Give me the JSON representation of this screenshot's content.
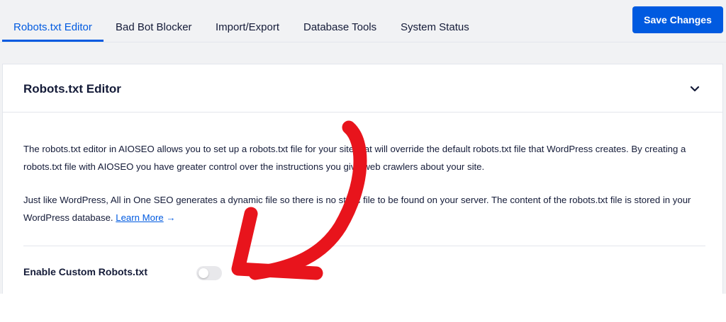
{
  "tabs": [
    {
      "label": "Robots.txt Editor",
      "active": true
    },
    {
      "label": "Bad Bot Blocker",
      "active": false
    },
    {
      "label": "Import/Export",
      "active": false
    },
    {
      "label": "Database Tools",
      "active": false
    },
    {
      "label": "System Status",
      "active": false
    }
  ],
  "header": {
    "save_label": "Save Changes"
  },
  "card": {
    "title": "Robots.txt Editor",
    "paragraph1": "The robots.txt editor in AIOSEO allows you to set up a robots.txt file for your site that will override the default robots.txt file that WordPress creates. By creating a robots.txt file with AIOSEO you have greater control over the instructions you give web crawlers about your site.",
    "paragraph2": "Just like WordPress, All in One SEO generates a dynamic file so there is no static file to be found on your server. The content of the robots.txt file is stored in your WordPress database.",
    "learn_more": "Learn More",
    "learn_more_arrow": "→",
    "setting_label": "Enable Custom Robots.txt",
    "toggle_on": false
  },
  "icons": {
    "chevron": "chevron-down-icon",
    "annotation": "red-arrow-annotation"
  },
  "colors": {
    "accent": "#005ae0",
    "text": "#141b38",
    "annotation": "#e8141c",
    "background": "#f1f2f4"
  }
}
